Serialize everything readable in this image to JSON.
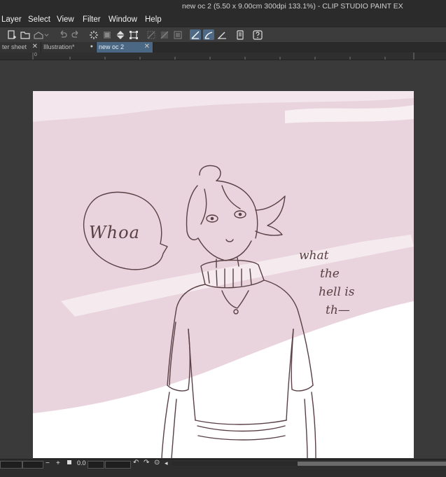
{
  "window": {
    "title": "new oc 2 (5.50 x 9.00cm 300dpi 133.1%)  - CLIP STUDIO PAINT EX"
  },
  "menu": [
    "Layer",
    "Select",
    "View",
    "Filter",
    "Window",
    "Help"
  ],
  "toolbar_icons": [
    "new-canvas-icon",
    "open-icon",
    "save-icon",
    "dropdown-icon",
    "undo-icon",
    "redo-icon",
    "loading-icon",
    "clear-icon",
    "fill-icon",
    "transform-icon",
    "hide-selection-icon",
    "deselect-icon",
    "invert-selection-icon",
    "snap-ruler-icon",
    "snap-special-icon",
    "snap-grid-icon",
    "smartphone-icon",
    "help-icon"
  ],
  "tabs": [
    {
      "label": "ter sheet",
      "close": "✕"
    },
    {
      "label": "Illustration*",
      "close": "●"
    },
    {
      "label": "new oc 2",
      "close": "✕"
    }
  ],
  "ruler": {
    "origin_label": "0"
  },
  "artwork": {
    "speech_bubble": "Whoa",
    "side_text": [
      "what",
      "the",
      "hell is",
      "th—"
    ]
  },
  "status": {
    "zoom": "0.0"
  },
  "colors": {
    "accent": "#4e6a86",
    "tab_active": "#4a6783",
    "line_art": "#5a4045",
    "pink_wash": "#e9d3dc"
  }
}
